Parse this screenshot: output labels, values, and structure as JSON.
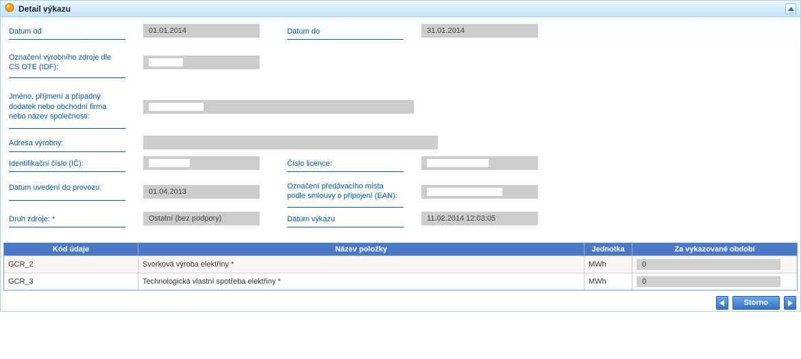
{
  "panel": {
    "title": "Detail výkazu"
  },
  "form": {
    "datum_od": {
      "label": "Datum od",
      "value": "01.01.2014"
    },
    "datum_do": {
      "label": "Datum do",
      "value": "31.01.2014"
    },
    "oznaceni_zdroje": {
      "label": "Označení výrobního zdroje dle CS OTE (IDF):",
      "value": ""
    },
    "jmeno": {
      "label": "Jméno, příjmení a případný dodatek nebo obchodní firma nebo název společnosti:",
      "value": ""
    },
    "adresa": {
      "label": "Adresa výrobny:",
      "value": ""
    },
    "ic": {
      "label": "Identifikační číslo (IČ):",
      "value": ""
    },
    "cislo_licence": {
      "label": "Číslo licence:",
      "value": ""
    },
    "datum_uvedeni": {
      "label": "Datum uvedení do provozu:",
      "value": "01.04.2013"
    },
    "oznaceni_mista": {
      "label": "Označení předávacího místa podle smlouvy o připojení (EAN):",
      "value": ""
    },
    "druh_zdroje": {
      "label": "Druh zdroje: *",
      "value": "Ostatní (bez podpory)"
    },
    "datum_vykazu": {
      "label": "Datum výkazu",
      "value": "11.02.2014 12:03:05"
    }
  },
  "grid": {
    "headers": {
      "kod": "Kód údaje",
      "nazev": "Název položky",
      "jednotka": "Jednotka",
      "obdobi": "Za vykazované období"
    },
    "rows": [
      {
        "kod": "GCR_2",
        "nazev": "Svorková výroba elektřiny *",
        "jednotka": "MWh",
        "obdobi": "0"
      },
      {
        "kod": "GCR_3",
        "nazev": "Technologická vlastní spotřeba elektřiny *",
        "jednotka": "MWh",
        "obdobi": "0"
      }
    ]
  },
  "footer": {
    "storno": "Storno"
  }
}
